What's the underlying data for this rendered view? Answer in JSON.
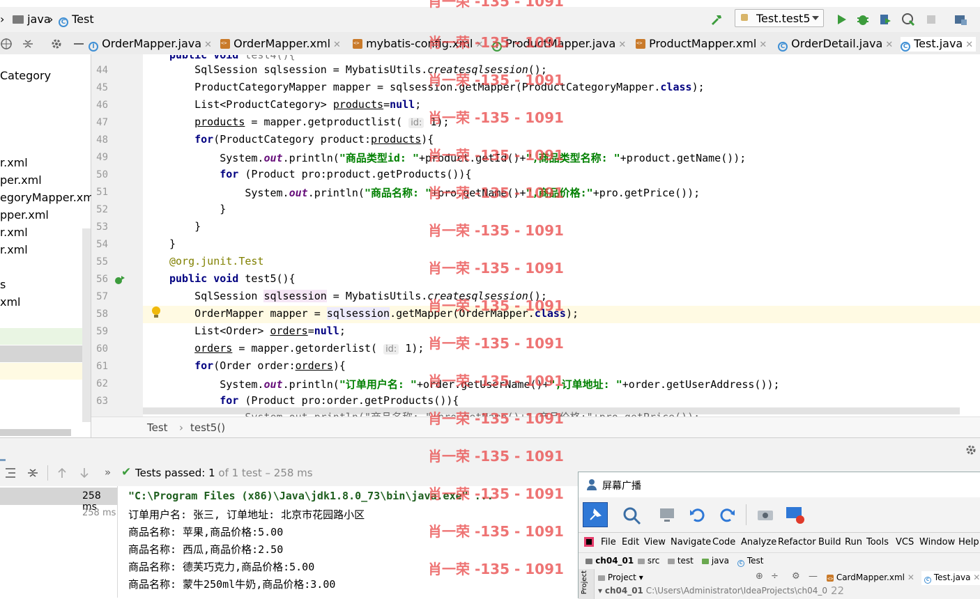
{
  "navbar": {
    "crumbs": [
      "java",
      "Test"
    ],
    "run_config": "Test.test5"
  },
  "tabs": [
    {
      "label": "OrderMapper.java",
      "type": "class"
    },
    {
      "label": "OrderMapper.xml",
      "type": "xml"
    },
    {
      "label": "mybatis-config.xml",
      "type": "xml"
    },
    {
      "label": "ProductMapper.java",
      "type": "class"
    },
    {
      "label": "ProductMapper.xml",
      "type": "xml"
    },
    {
      "label": "OrderDetail.java",
      "type": "class"
    },
    {
      "label": "Test.java",
      "type": "class",
      "active": true
    }
  ],
  "left_panel": {
    "items": [
      "Category",
      "r.xml",
      "per.xml",
      "egoryMapper.xml",
      "pper.xml",
      "r.xml",
      "r.xml",
      "s",
      "xml"
    ]
  },
  "editor": {
    "lines": [
      {
        "n": "44",
        "html": "    SqlSession sqlsession = MybatisUtils.<span class='it'>createsqlsession</span>();"
      },
      {
        "n": "45",
        "html": "    ProductCategoryMapper mapper = sqlsession.getMapper(ProductCategoryMapper.<span class='kw'>class</span>);"
      },
      {
        "n": "46",
        "html": "    List&lt;ProductCategory&gt; <span class='ul'>products</span>=<span class='kw'>null</span>;"
      },
      {
        "n": "47",
        "html": "    <span class='ul'>products</span> = mapper.getproductlist( <span class='hint'>id:</span> 1);"
      },
      {
        "n": "48",
        "html": "    <span class='kw'>for</span>(ProductCategory product:<span class='ul'>products</span>){"
      },
      {
        "n": "49",
        "html": "        System.<span class='fld'>out</span>.println(<span class='str'>\"商品类型id: \"</span>+product.getId()+<span class='str'>\",商品类型名称: \"</span>+product.getName());"
      },
      {
        "n": "50",
        "html": "        <span class='kw'>for</span> (Product pro:product.getProducts()){"
      },
      {
        "n": "51",
        "html": "            System.<span class='fld'>out</span>.println(<span class='str'>\"商品名称: \"</span>+pro.getName()+<span class='str'>\",商品价格:\"</span>+pro.getPrice());"
      },
      {
        "n": "52",
        "html": "        }"
      },
      {
        "n": "53",
        "html": "    }"
      },
      {
        "n": "54",
        "html": "}"
      },
      {
        "n": "55",
        "html": "<span class='anno'>@org.junit.Test</span>"
      },
      {
        "n": "56",
        "html": "<span class='kw'>public void</span> test5(){"
      },
      {
        "n": "57",
        "html": "    SqlSession <span class='hlv'>sqlsession</span> = MybatisUtils.<span class='it'>createsqlsession</span>();"
      },
      {
        "n": "58",
        "html": "    OrderMapper mapper = <span class='hlv2'>sqlsession</span>.getMapper(OrderMapper.<span class='kw'>class</span>);"
      },
      {
        "n": "59",
        "html": "    List&lt;Order&gt; <span class='ul'>orders</span>=<span class='kw'>null</span>;"
      },
      {
        "n": "60",
        "html": "    <span class='ul'>orders</span> = mapper.getorderlist( <span class='hint'>id:</span> 1);"
      },
      {
        "n": "61",
        "html": "    <span class='kw'>for</span>(Order order:<span class='ul'>orders</span>){"
      },
      {
        "n": "62",
        "html": "        System.<span class='fld'>out</span>.println(<span class='str'>\"订单用户名: \"</span>+order.getUserName()+<span class='str'>\",订单地址: \"</span>+order.getUserAddress());"
      },
      {
        "n": "63",
        "html": "        <span class='kw'>for</span> (Product pro:order.getProducts()){"
      }
    ],
    "breadcrumb": [
      "Test",
      "test5()"
    ]
  },
  "run": {
    "status_prefix": "Tests passed:",
    "status_count": "1",
    "status_suffix": "of 1 test – 258 ms",
    "tree_times": [
      "258 ms",
      "258 ms"
    ],
    "console": [
      "\"C:\\Program Files (x86)\\Java\\jdk1.8.0_73\\bin\\java.exe\" ...",
      "订单用户名: 张三, 订单地址: 北京市花园路小区",
      "商品名称: 苹果,商品价格:5.00",
      "商品名称: 西瓜,商品价格:2.50",
      "商品名称: 德芙巧克力,商品价格:5.00",
      "商品名称: 蒙牛250ml牛奶,商品价格:3.00"
    ]
  },
  "overlay": {
    "title": "屏幕广播",
    "menu": [
      "File",
      "Edit",
      "View",
      "Navigate",
      "Code",
      "Analyze",
      "Refactor",
      "Build",
      "Run",
      "Tools",
      "VCS",
      "Window",
      "Help"
    ],
    "crumbs": [
      "ch04_01",
      "src",
      "test",
      "java",
      "Test"
    ],
    "project_label": "Project",
    "tabs": [
      "CardMapper.xml",
      "Test.java"
    ],
    "tree_root": "ch04_01",
    "tree_path": "C:\\Users\\Administrator\\IdeaProjects\\ch04_01",
    "line_no": "22",
    "side_label": "Project"
  },
  "watermark": "肖一荣 -135 - 1091",
  "colors": {
    "keyword": "#000080",
    "string": "#008000",
    "green_run": "#3c9c3c",
    "watermark": "#e84646"
  }
}
